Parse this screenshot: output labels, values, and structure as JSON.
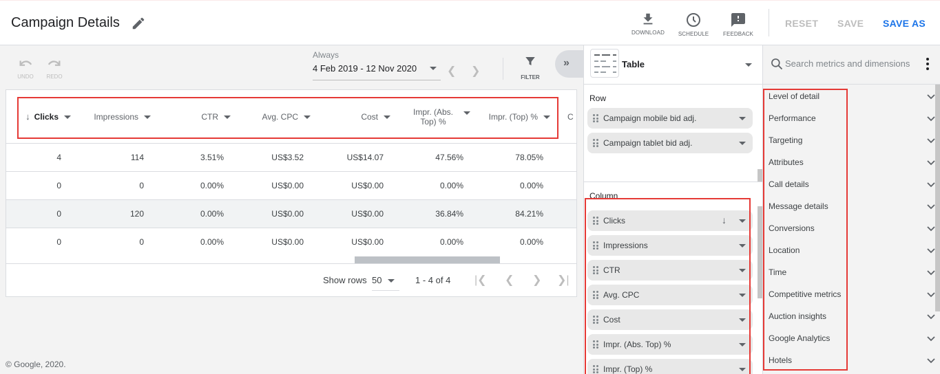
{
  "header": {
    "title": "Campaign Details",
    "actions": [
      {
        "label": "DOWNLOAD",
        "icon": "download-icon"
      },
      {
        "label": "SCHEDULE",
        "icon": "clock-icon"
      },
      {
        "label": "FEEDBACK",
        "icon": "feedback-icon"
      }
    ],
    "reset_label": "RESET",
    "save_label": "SAVE",
    "save_as_label": "SAVE AS",
    "accent_color": "#1a73e8"
  },
  "toolbar": {
    "undo_label": "UNDO",
    "redo_label": "REDO",
    "date_range_label": "Always",
    "date_range_value": "4 Feb 2019 - 12 Nov 2020",
    "filter_label": "FILTER"
  },
  "table": {
    "columns": [
      {
        "label": "Clicks",
        "sorted": "desc"
      },
      {
        "label": "Impressions"
      },
      {
        "label": "CTR"
      },
      {
        "label": "Avg. CPC"
      },
      {
        "label": "Cost"
      },
      {
        "label": "Impr. (Abs. Top) %"
      },
      {
        "label": "Impr. (Top) %"
      },
      {
        "label": "C"
      }
    ],
    "rows": [
      [
        "4",
        "114",
        "3.51%",
        "US$3.52",
        "US$14.07",
        "47.56%",
        "78.05%"
      ],
      [
        "0",
        "0",
        "0.00%",
        "US$0.00",
        "US$0.00",
        "0.00%",
        "0.00%"
      ],
      [
        "0",
        "120",
        "0.00%",
        "US$0.00",
        "US$0.00",
        "36.84%",
        "84.21%"
      ],
      [
        "0",
        "0",
        "0.00%",
        "US$0.00",
        "US$0.00",
        "0.00%",
        "0.00%"
      ]
    ],
    "footer": {
      "show_rows_label": "Show rows",
      "rows_per_page": "50",
      "range_text": "1 - 4 of 4"
    }
  },
  "editor": {
    "chart_type": "Table",
    "row_label": "Row",
    "rows": [
      "Campaign mobile bid adj.",
      "Campaign tablet bid adj."
    ],
    "column_label": "Column",
    "columns": [
      {
        "label": "Clicks",
        "sorted": "desc"
      },
      {
        "label": "Impressions"
      },
      {
        "label": "CTR"
      },
      {
        "label": "Avg. CPC"
      },
      {
        "label": "Cost"
      },
      {
        "label": "Impr. (Abs. Top) %"
      },
      {
        "label": "Impr. (Top) %"
      }
    ]
  },
  "metrics_panel": {
    "search_placeholder": "Search metrics and dimensions",
    "categories": [
      "Level of detail",
      "Performance",
      "Targeting",
      "Attributes",
      "Call details",
      "Message details",
      "Conversions",
      "Location",
      "Time",
      "Competitive metrics",
      "Auction insights",
      "Google Analytics",
      "Hotels"
    ]
  },
  "footer": {
    "copyright": "© Google, 2020."
  }
}
